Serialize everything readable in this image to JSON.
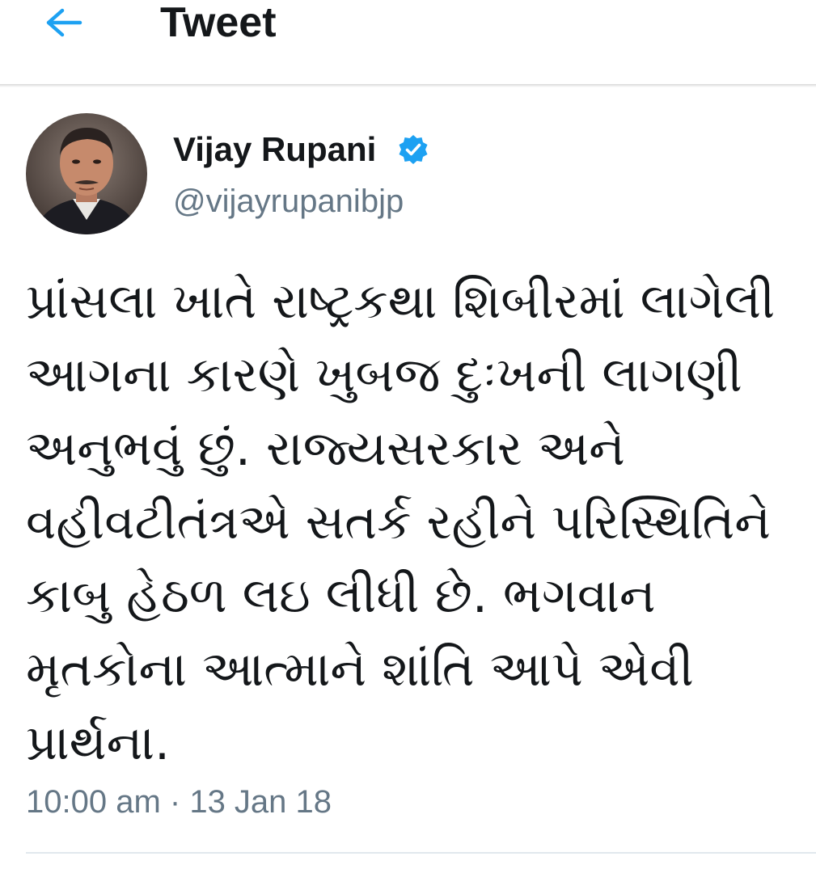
{
  "header": {
    "title": "Tweet",
    "back_icon": "arrow-left-icon",
    "accent_color": "#1da1f2"
  },
  "tweet": {
    "author": {
      "name": "Vijay Rupani",
      "handle": "@vijayrupanibjp",
      "verified": true,
      "verified_icon": "verified-badge-icon"
    },
    "text": "પ્રાંસલા ખાતે રાષ્ટ્રકથા શિબીરમાં લાગેલી આગના કારણે ખુબજ દુઃખની લાગણી અનુભવું છું. રાજ્યસરકાર અને વહીવટીતંત્રએ સતર્ક રહીને પરિસ્થિતિને કાબુ હેઠળ લઇ લીધી છે. ભગવાન મૃતકોના આત્માને શાંતિ આપે એવી પ્રાર્થના.",
    "timestamp": "10:00 am · 13 Jan 18"
  }
}
